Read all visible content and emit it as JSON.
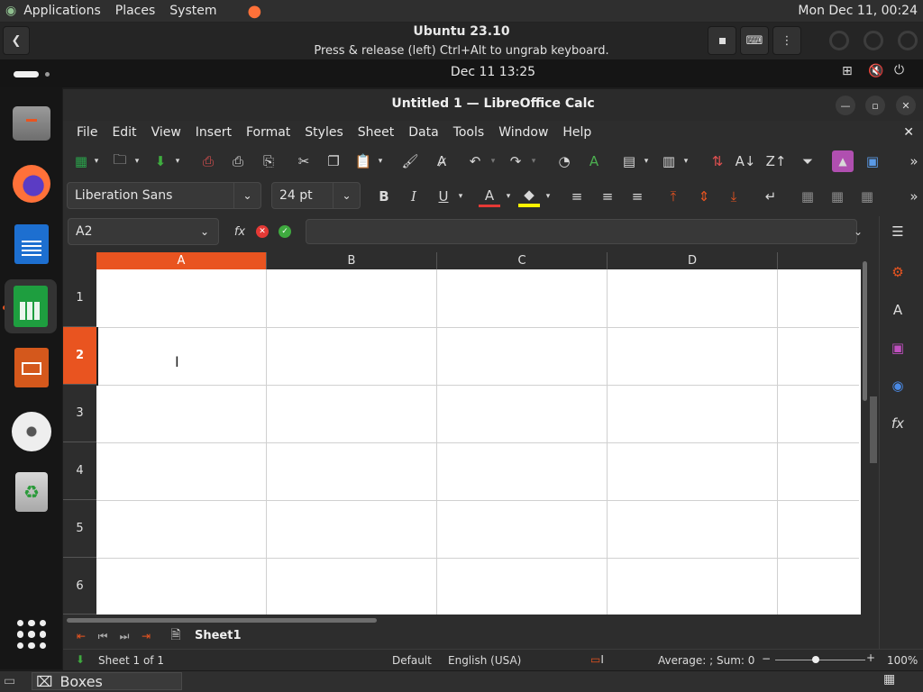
{
  "host": {
    "menus": [
      "Applications",
      "Places",
      "System"
    ],
    "clock": "Mon Dec 11, 00:24",
    "taskbar_item": "Boxes"
  },
  "boxes": {
    "title": "Ubuntu 23.10",
    "subtitle": "Press & release (left) Ctrl+Alt to ungrab keyboard."
  },
  "guest": {
    "clock": "Dec 11  13:25"
  },
  "dock": {
    "items": [
      "files-icon",
      "firefox-icon",
      "writer-icon",
      "calc-icon",
      "impress-icon",
      "disc-icon",
      "trash-icon"
    ]
  },
  "calc": {
    "title": "Untitled 1 — LibreOffice Calc",
    "menu": [
      "File",
      "Edit",
      "View",
      "Insert",
      "Format",
      "Styles",
      "Sheet",
      "Data",
      "Tools",
      "Window",
      "Help"
    ],
    "font_name": "Liberation Sans",
    "font_size": "24 pt",
    "name_box": "A2",
    "formula_value": "",
    "columns": [
      "A",
      "B",
      "C",
      "D"
    ],
    "rows": [
      "1",
      "2",
      "3",
      "4",
      "5",
      "6"
    ],
    "active_col": "A",
    "active_row": "2",
    "sheet_tab": "Sheet1",
    "status": {
      "sheet": "Sheet 1 of 1",
      "style": "Default",
      "language": "English (USA)",
      "summary": "Average: ; Sum: 0",
      "zoom": "100%"
    }
  },
  "colors": {
    "accent": "#e95420",
    "grid_line": "#d0d0d0",
    "panel": "#2d2d2d"
  }
}
